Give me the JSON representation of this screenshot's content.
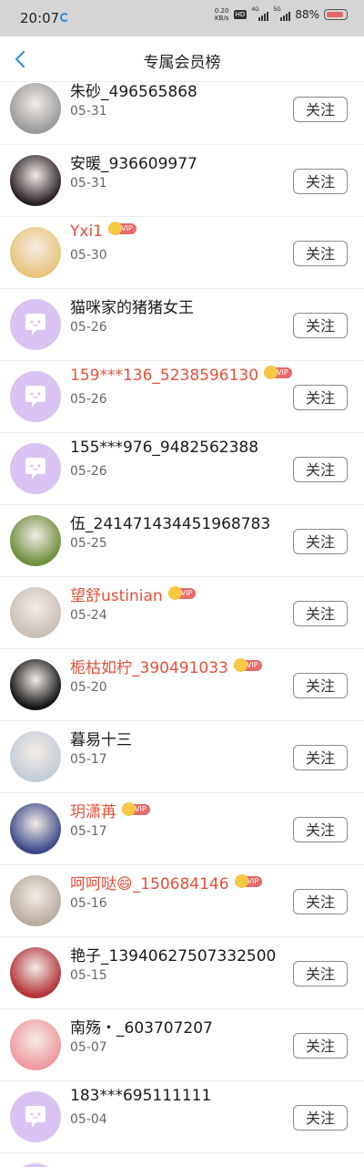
{
  "status_bar": {
    "time": "20:07",
    "net_speed": "0.20 KB/s",
    "hd": "HD",
    "sig1": "4G",
    "sig2": "5G",
    "battery": "88%"
  },
  "nav": {
    "title": "专属会员榜"
  },
  "follow_label": "关注",
  "vip_label": "VIP",
  "members": [
    {
      "name": "朱砂_496565868",
      "date": "05-31",
      "vip": false,
      "avatar": "photo",
      "color": "#9a9a9a"
    },
    {
      "name": "安暖_936609977",
      "date": "05-31",
      "vip": false,
      "avatar": "photo",
      "color": "#2a2228"
    },
    {
      "name": "Yxi1",
      "date": "05-30",
      "vip": true,
      "avatar": "photo",
      "color": "#e9c57a"
    },
    {
      "name": "猫咪家的猪猪女王",
      "date": "05-26",
      "vip": false,
      "avatar": "default"
    },
    {
      "name": "159***136_5238596130",
      "date": "05-26",
      "vip": true,
      "avatar": "default"
    },
    {
      "name": "155***976_9482562388",
      "date": "05-26",
      "vip": false,
      "avatar": "default"
    },
    {
      "name": "伍_241471434451968783",
      "date": "05-25",
      "vip": false,
      "avatar": "photo",
      "color": "#6f8f3e"
    },
    {
      "name": "望舒ustinian",
      "date": "05-24",
      "vip": true,
      "avatar": "photo",
      "color": "#c9c0b8"
    },
    {
      "name": "栀枯如柠_390491033",
      "date": "05-20",
      "vip": true,
      "avatar": "photo",
      "color": "#141414"
    },
    {
      "name": "暮易十三",
      "date": "05-17",
      "vip": false,
      "avatar": "photo",
      "color": "#c4cdd8"
    },
    {
      "name": "玥潇苒",
      "date": "05-17",
      "vip": true,
      "avatar": "photo",
      "color": "#3c4a8a"
    },
    {
      "name": "呵呵哒😄_150684146",
      "date": "05-16",
      "vip": true,
      "avatar": "photo",
      "color": "#b9aca0"
    },
    {
      "name": "艳子_13940627507332500",
      "date": "05-15",
      "vip": false,
      "avatar": "photo",
      "color": "#b3343a"
    },
    {
      "name": "南殇・_603707207",
      "date": "05-07",
      "vip": false,
      "avatar": "photo",
      "color": "#f09aa0"
    },
    {
      "name": "183***695111111",
      "date": "05-04",
      "vip": false,
      "avatar": "default"
    },
    {
      "name": "",
      "date": "",
      "vip": false,
      "avatar": "default"
    }
  ]
}
